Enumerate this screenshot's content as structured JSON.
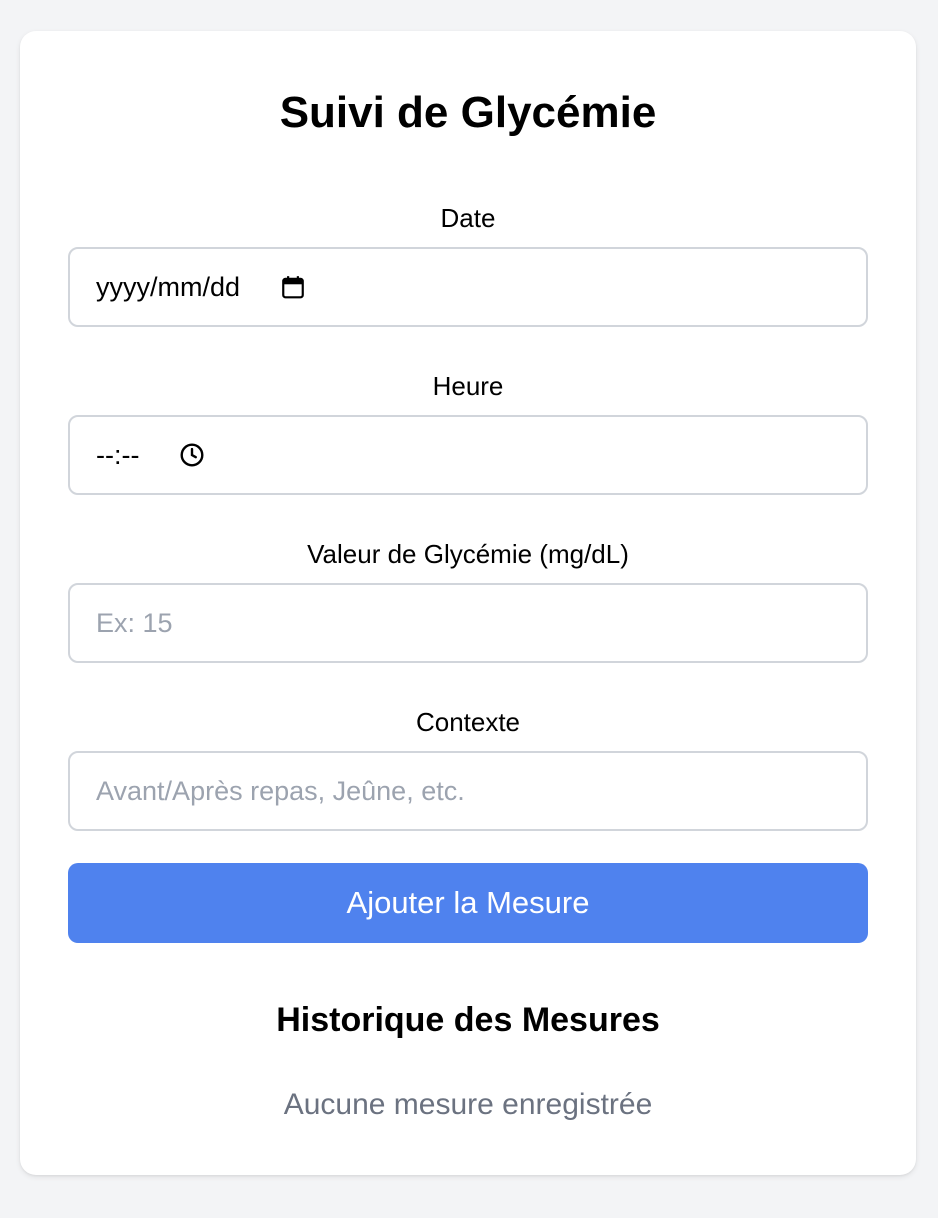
{
  "app": {
    "title": "Suivi de Glycémie"
  },
  "form": {
    "date": {
      "label": "Date",
      "value": "yyyy/mm/dd",
      "icon": "calendar-icon"
    },
    "time": {
      "label": "Heure",
      "value": "--:--",
      "icon": "clock-icon"
    },
    "glucose": {
      "label": "Valeur de Glycémie (mg/dL)",
      "placeholder": "Ex: 15"
    },
    "context": {
      "label": "Contexte",
      "placeholder": "Avant/Après repas, Jeûne, etc."
    },
    "submit_label": "Ajouter la Mesure"
  },
  "history": {
    "title": "Historique des Mesures",
    "empty_text": "Aucune mesure enregistrée"
  },
  "colors": {
    "background": "#f3f4f6",
    "card": "#ffffff",
    "accent": "#4f82ee",
    "border": "#d1d5db",
    "placeholder": "#9ca3af",
    "muted_text": "#6b7280"
  }
}
